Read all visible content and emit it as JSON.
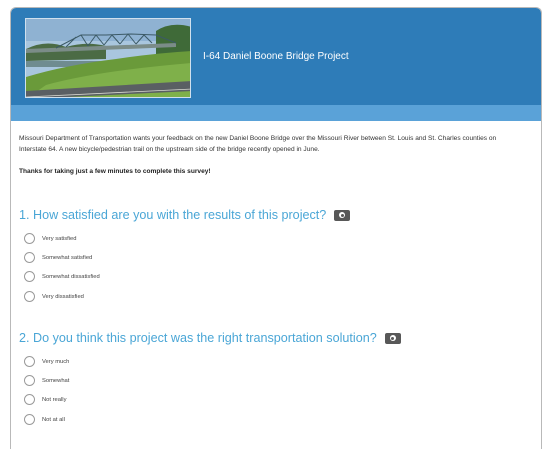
{
  "header": {
    "title": "I-64 Daniel Boone Bridge Project",
    "background": "#2e7cb8",
    "band": "#5aa2d8",
    "image_icon": "bridge-photo"
  },
  "intro": {
    "text": "Missouri Department of Transportation wants your feedback on the new Daniel Boone Bridge over the Missouri River between St. Louis and St. Charles counties on Interstate 64. A new bicycle/pedestrian trail on the upstream side of the bridge recently opened in June.",
    "thanks": "Thanks for taking just a few minutes to complete this survey!"
  },
  "questions": [
    {
      "text": "1. How satisfied are you with the results of this project?",
      "icon": "camera-icon",
      "options": [
        "Very satisfied",
        "Somewhat satisfied",
        "Somewhat dissatisfied",
        "Very dissatisfied"
      ]
    },
    {
      "text": "2. Do you think this project was the right transportation solution?",
      "icon": "camera-icon",
      "options": [
        "Very much",
        "Somewhat",
        "Not really",
        "Not at all"
      ]
    }
  ],
  "colors": {
    "question": "#4aa6d6",
    "text": "#333333"
  }
}
